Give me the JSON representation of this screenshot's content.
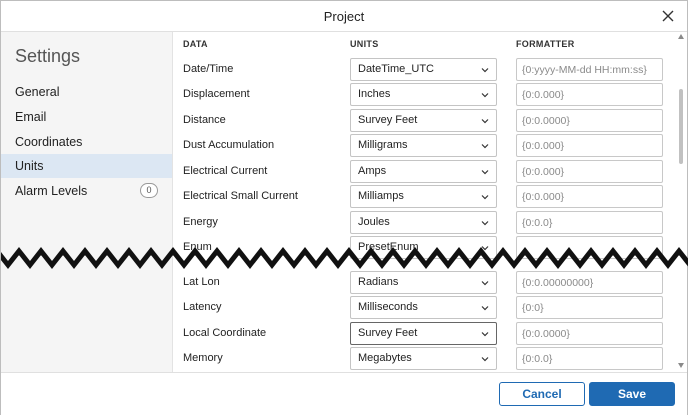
{
  "window": {
    "title": "Project",
    "close_icon": "close-icon"
  },
  "sidebar": {
    "heading": "Settings",
    "items": [
      {
        "label": "General",
        "active": false
      },
      {
        "label": "Email",
        "active": false
      },
      {
        "label": "Coordinates",
        "active": false
      },
      {
        "label": "Units",
        "active": true
      },
      {
        "label": "Alarm Levels",
        "active": false,
        "badge": "0"
      }
    ]
  },
  "table": {
    "headers": {
      "data": "DATA",
      "units": "UNITS",
      "formatter": "FORMATTER"
    },
    "rows": [
      {
        "label": "Date/Time",
        "unit": "DateTime_UTC",
        "formatter": "",
        "placeholder": "{0:yyyy-MM-dd HH:mm:ss}"
      },
      {
        "label": "Displacement",
        "unit": "Inches",
        "formatter": "",
        "placeholder": "{0:0.000}"
      },
      {
        "label": "Distance",
        "unit": "Survey Feet",
        "formatter": "",
        "placeholder": "{0:0.0000}"
      },
      {
        "label": "Dust Accumulation",
        "unit": "Milligrams",
        "formatter": "",
        "placeholder": "{0:0.000}"
      },
      {
        "label": "Electrical Current",
        "unit": "Amps",
        "formatter": "",
        "placeholder": "{0:0.000}"
      },
      {
        "label": "Electrical Small Current",
        "unit": "Milliamps",
        "formatter": "",
        "placeholder": "{0:0.000}"
      },
      {
        "label": "Energy",
        "unit": "Joules",
        "formatter": "",
        "placeholder": "{0:0.0}"
      },
      {
        "label": "Enum",
        "unit": "PresetEnum",
        "formatter": "",
        "placeholder": ""
      },
      {
        "label": "Lat Lon",
        "unit": "Radians",
        "formatter": "",
        "placeholder": "{0:0.00000000}"
      },
      {
        "label": "Latency",
        "unit": "Milliseconds",
        "formatter": "",
        "placeholder": "{0:0}"
      },
      {
        "label": "Local Coordinate",
        "unit": "Survey Feet",
        "formatter": "",
        "placeholder": "{0:0.0000}"
      },
      {
        "label": "Memory",
        "unit": "Megabytes",
        "formatter": "",
        "placeholder": "{0:0.0}"
      }
    ]
  },
  "footer": {
    "cancel_label": "Cancel",
    "save_label": "Save"
  },
  "colors": {
    "accent": "#1f6ab3",
    "sidebar_bg": "#f5f5f5",
    "active_item_bg": "#dce7f3"
  }
}
